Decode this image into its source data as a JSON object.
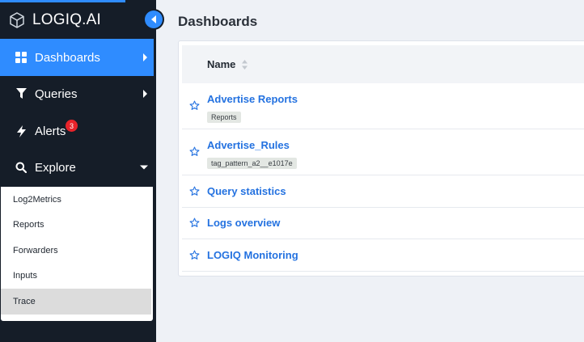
{
  "brand": {
    "name": "LOGIQ.AI"
  },
  "sidebar": {
    "nav": [
      {
        "label": "Dashboards",
        "icon": "grid-icon",
        "active": true
      },
      {
        "label": "Queries",
        "icon": "filter-icon"
      },
      {
        "label": "Alerts",
        "icon": "bolt-icon",
        "badge": "3"
      },
      {
        "label": "Explore",
        "icon": "search-icon"
      }
    ],
    "explore_items": [
      "Log2Metrics",
      "Reports",
      "Forwarders",
      "Inputs",
      "Trace"
    ],
    "selected_explore_item": "Trace"
  },
  "main": {
    "title": "Dashboards",
    "table": {
      "column_name": "Name",
      "rows": [
        {
          "title": "Advertise Reports",
          "tag": "Reports"
        },
        {
          "title": "Advertise_Rules",
          "tag": "tag_pattern_a2__e1017e"
        },
        {
          "title": "Query statistics"
        },
        {
          "title": "Logs overview"
        },
        {
          "title": "LOGIQ Monitoring"
        }
      ]
    }
  },
  "colors": {
    "sidebar_bg": "#151d28",
    "accent": "#2f8cff",
    "link": "#2472e0",
    "badge": "#e8232a",
    "page_bg": "#eef1f6"
  }
}
